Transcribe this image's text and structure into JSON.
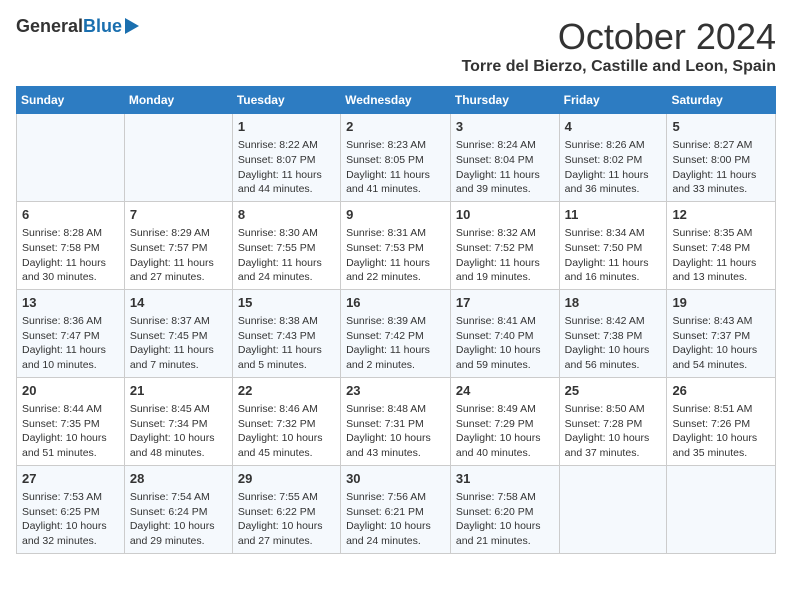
{
  "header": {
    "logo_general": "General",
    "logo_blue": "Blue",
    "month": "October 2024",
    "location": "Torre del Bierzo, Castille and Leon, Spain"
  },
  "days_of_week": [
    "Sunday",
    "Monday",
    "Tuesday",
    "Wednesday",
    "Thursday",
    "Friday",
    "Saturday"
  ],
  "weeks": [
    [
      {
        "day": "",
        "info": ""
      },
      {
        "day": "",
        "info": ""
      },
      {
        "day": "1",
        "info": "Sunrise: 8:22 AM\nSunset: 8:07 PM\nDaylight: 11 hours and 44 minutes."
      },
      {
        "day": "2",
        "info": "Sunrise: 8:23 AM\nSunset: 8:05 PM\nDaylight: 11 hours and 41 minutes."
      },
      {
        "day": "3",
        "info": "Sunrise: 8:24 AM\nSunset: 8:04 PM\nDaylight: 11 hours and 39 minutes."
      },
      {
        "day": "4",
        "info": "Sunrise: 8:26 AM\nSunset: 8:02 PM\nDaylight: 11 hours and 36 minutes."
      },
      {
        "day": "5",
        "info": "Sunrise: 8:27 AM\nSunset: 8:00 PM\nDaylight: 11 hours and 33 minutes."
      }
    ],
    [
      {
        "day": "6",
        "info": "Sunrise: 8:28 AM\nSunset: 7:58 PM\nDaylight: 11 hours and 30 minutes."
      },
      {
        "day": "7",
        "info": "Sunrise: 8:29 AM\nSunset: 7:57 PM\nDaylight: 11 hours and 27 minutes."
      },
      {
        "day": "8",
        "info": "Sunrise: 8:30 AM\nSunset: 7:55 PM\nDaylight: 11 hours and 24 minutes."
      },
      {
        "day": "9",
        "info": "Sunrise: 8:31 AM\nSunset: 7:53 PM\nDaylight: 11 hours and 22 minutes."
      },
      {
        "day": "10",
        "info": "Sunrise: 8:32 AM\nSunset: 7:52 PM\nDaylight: 11 hours and 19 minutes."
      },
      {
        "day": "11",
        "info": "Sunrise: 8:34 AM\nSunset: 7:50 PM\nDaylight: 11 hours and 16 minutes."
      },
      {
        "day": "12",
        "info": "Sunrise: 8:35 AM\nSunset: 7:48 PM\nDaylight: 11 hours and 13 minutes."
      }
    ],
    [
      {
        "day": "13",
        "info": "Sunrise: 8:36 AM\nSunset: 7:47 PM\nDaylight: 11 hours and 10 minutes."
      },
      {
        "day": "14",
        "info": "Sunrise: 8:37 AM\nSunset: 7:45 PM\nDaylight: 11 hours and 7 minutes."
      },
      {
        "day": "15",
        "info": "Sunrise: 8:38 AM\nSunset: 7:43 PM\nDaylight: 11 hours and 5 minutes."
      },
      {
        "day": "16",
        "info": "Sunrise: 8:39 AM\nSunset: 7:42 PM\nDaylight: 11 hours and 2 minutes."
      },
      {
        "day": "17",
        "info": "Sunrise: 8:41 AM\nSunset: 7:40 PM\nDaylight: 10 hours and 59 minutes."
      },
      {
        "day": "18",
        "info": "Sunrise: 8:42 AM\nSunset: 7:38 PM\nDaylight: 10 hours and 56 minutes."
      },
      {
        "day": "19",
        "info": "Sunrise: 8:43 AM\nSunset: 7:37 PM\nDaylight: 10 hours and 54 minutes."
      }
    ],
    [
      {
        "day": "20",
        "info": "Sunrise: 8:44 AM\nSunset: 7:35 PM\nDaylight: 10 hours and 51 minutes."
      },
      {
        "day": "21",
        "info": "Sunrise: 8:45 AM\nSunset: 7:34 PM\nDaylight: 10 hours and 48 minutes."
      },
      {
        "day": "22",
        "info": "Sunrise: 8:46 AM\nSunset: 7:32 PM\nDaylight: 10 hours and 45 minutes."
      },
      {
        "day": "23",
        "info": "Sunrise: 8:48 AM\nSunset: 7:31 PM\nDaylight: 10 hours and 43 minutes."
      },
      {
        "day": "24",
        "info": "Sunrise: 8:49 AM\nSunset: 7:29 PM\nDaylight: 10 hours and 40 minutes."
      },
      {
        "day": "25",
        "info": "Sunrise: 8:50 AM\nSunset: 7:28 PM\nDaylight: 10 hours and 37 minutes."
      },
      {
        "day": "26",
        "info": "Sunrise: 8:51 AM\nSunset: 7:26 PM\nDaylight: 10 hours and 35 minutes."
      }
    ],
    [
      {
        "day": "27",
        "info": "Sunrise: 7:53 AM\nSunset: 6:25 PM\nDaylight: 10 hours and 32 minutes."
      },
      {
        "day": "28",
        "info": "Sunrise: 7:54 AM\nSunset: 6:24 PM\nDaylight: 10 hours and 29 minutes."
      },
      {
        "day": "29",
        "info": "Sunrise: 7:55 AM\nSunset: 6:22 PM\nDaylight: 10 hours and 27 minutes."
      },
      {
        "day": "30",
        "info": "Sunrise: 7:56 AM\nSunset: 6:21 PM\nDaylight: 10 hours and 24 minutes."
      },
      {
        "day": "31",
        "info": "Sunrise: 7:58 AM\nSunset: 6:20 PM\nDaylight: 10 hours and 21 minutes."
      },
      {
        "day": "",
        "info": ""
      },
      {
        "day": "",
        "info": ""
      }
    ]
  ]
}
